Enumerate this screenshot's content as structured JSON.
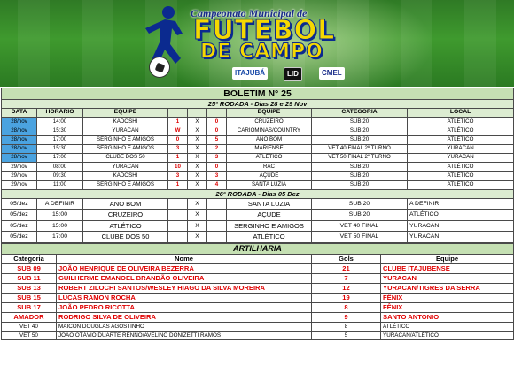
{
  "banner": {
    "subtitle": "Campeonato Municipal de",
    "title_line1": "FUTEBOL",
    "title_line2": "DE CAMPO",
    "sponsors": [
      "ITAJUBÁ",
      "LID",
      "CMEL"
    ]
  },
  "boletim": {
    "title": "BOLETIM N° 25",
    "round1_title": "25ª RODADA -  Dias 28 e 29 Nov",
    "columns": [
      "DATA",
      "HORÁRIO",
      "EQUIPE",
      "",
      "",
      "",
      "EQUIPE",
      "CATEGORIA",
      "LOCAL"
    ],
    "round1": [
      {
        "date": "28/nov",
        "time": "14:00",
        "home": "KADOSHI",
        "hs": "1",
        "x": "X",
        "as": "0",
        "away": "CRUZEIRO",
        "cat": "SUB 20",
        "local": "ATLÉTICO",
        "blue": true
      },
      {
        "date": "28/nov",
        "time": "15:30",
        "home": "YURACAN",
        "hs": "W",
        "x": "X",
        "as": "0",
        "away": "CARIOMINAS/COUNTRY",
        "cat": "SUB 20",
        "local": "ATLÉTICO",
        "blue": true
      },
      {
        "date": "28/nov",
        "time": "17:00",
        "home": "SERGINHO E AMIGOS",
        "hs": "0",
        "x": "X",
        "as": "5",
        "away": "ANO BOM",
        "cat": "SUB 20",
        "local": "ATLÉTICO",
        "blue": true
      },
      {
        "date": "28/nov",
        "time": "15:30",
        "home": "SERGINHO E AMIGOS",
        "hs": "3",
        "x": "X",
        "as": "2",
        "away": "MARIENSE",
        "cat": "VET 40 FINAL 2º TURNO",
        "local": "YURACAN",
        "blue": true
      },
      {
        "date": "28/nov",
        "time": "17:00",
        "home": "CLUBE DOS 50",
        "hs": "1",
        "x": "X",
        "as": "3",
        "away": "ATLÉTICO",
        "cat": "VET 50 FINAL 2º TURNO",
        "local": "YURACAN",
        "blue": true
      },
      {
        "date": "29/nov",
        "time": "08:00",
        "home": "YURACAN",
        "hs": "10",
        "x": "X",
        "as": "0",
        "away": "RAC",
        "cat": "SUB 20",
        "local": "ATLÉTICO",
        "blue": false
      },
      {
        "date": "29/nov",
        "time": "09:30",
        "home": "KADOSHI",
        "hs": "3",
        "x": "X",
        "as": "3",
        "away": "AÇUDE",
        "cat": "SUB 20",
        "local": "ATLÉTICO",
        "blue": false
      },
      {
        "date": "29/nov",
        "time": "11:00",
        "home": "SERGINHO E AMIGOS",
        "hs": "1",
        "x": "X",
        "as": "4",
        "away": "SANTA LUZIA",
        "cat": "SUB 20",
        "local": "ATLÉTICO",
        "blue": false
      }
    ],
    "round2_title": "26ª RODADA -  Dias 05 Dez",
    "round2": [
      {
        "date": "05/dez",
        "time": "A DEFINIR",
        "home": "ANO BOM",
        "x": "X",
        "away": "SANTA LUZIA",
        "cat": "SUB 20",
        "local": "A DEFINIR"
      },
      {
        "date": "05/dez",
        "time": "15:00",
        "home": "CRUZEIRO",
        "x": "X",
        "away": "AÇUDE",
        "cat": "SUB 20",
        "local": "ATLÉTICO"
      },
      {
        "date": "05/dez",
        "time": "15:00",
        "home": "ATLÉTICO",
        "x": "X",
        "away": "SERGINHO E AMIGOS",
        "cat": "VET 40 FINAL",
        "local": "YURACAN"
      },
      {
        "date": "05/dez",
        "time": "17:00",
        "home": "CLUBE DOS 50",
        "x": "X",
        "away": "ATLÉTICO",
        "cat": "VET 50 FINAL",
        "local": "YURACAN"
      }
    ]
  },
  "artilharia": {
    "title": "ARTILHARIA",
    "columns": [
      "Categoria",
      "Nome",
      "Gols",
      "Equipe"
    ],
    "rows": [
      {
        "cat": "SUB 09",
        "name": "JOÃO HENRIQUE DE OLIVEIRA BEZERRA",
        "gols": "21",
        "team": "CLUBE ITAJUBENSE",
        "big": true
      },
      {
        "cat": "SUB 11",
        "name": "GUILHERME EMANOEL BRANDÃO OLIVEIRA",
        "gols": "7",
        "team": "YURACAN",
        "big": true
      },
      {
        "cat": "SUB 13",
        "name": "ROBERT ZILOCHI SANTOS/WESLEY HIAGO DA SILVA MOREIRA",
        "gols": "12",
        "team": "YURACAN/TIGRES DA SERRA",
        "big": true
      },
      {
        "cat": "SUB 15",
        "name": "LUCAS RAMON ROCHA",
        "gols": "19",
        "team": "FÊNIX",
        "big": true
      },
      {
        "cat": "SUB 17",
        "name": "JOÃO PEDRO RICOTTA",
        "gols": "8",
        "team": "FÊNIX",
        "big": true
      },
      {
        "cat": "AMADOR",
        "name": "RODRIGO SILVA DE OLIVEIRA",
        "gols": "9",
        "team": "SANTO ANTONIO",
        "big": true
      },
      {
        "cat": "VET 40",
        "name": "MAICON DOUGLAS AGOSTINHO",
        "gols": "8",
        "team": "ATLÉTICO",
        "big": false
      },
      {
        "cat": "VET 50",
        "name": "JOÃO OTÁVIO DUARTE RENNÓ/AVELINO DONIZETTI RAMOS",
        "gols": "5",
        "team": "YURACAN/ATLÉTICO",
        "big": false
      }
    ]
  }
}
